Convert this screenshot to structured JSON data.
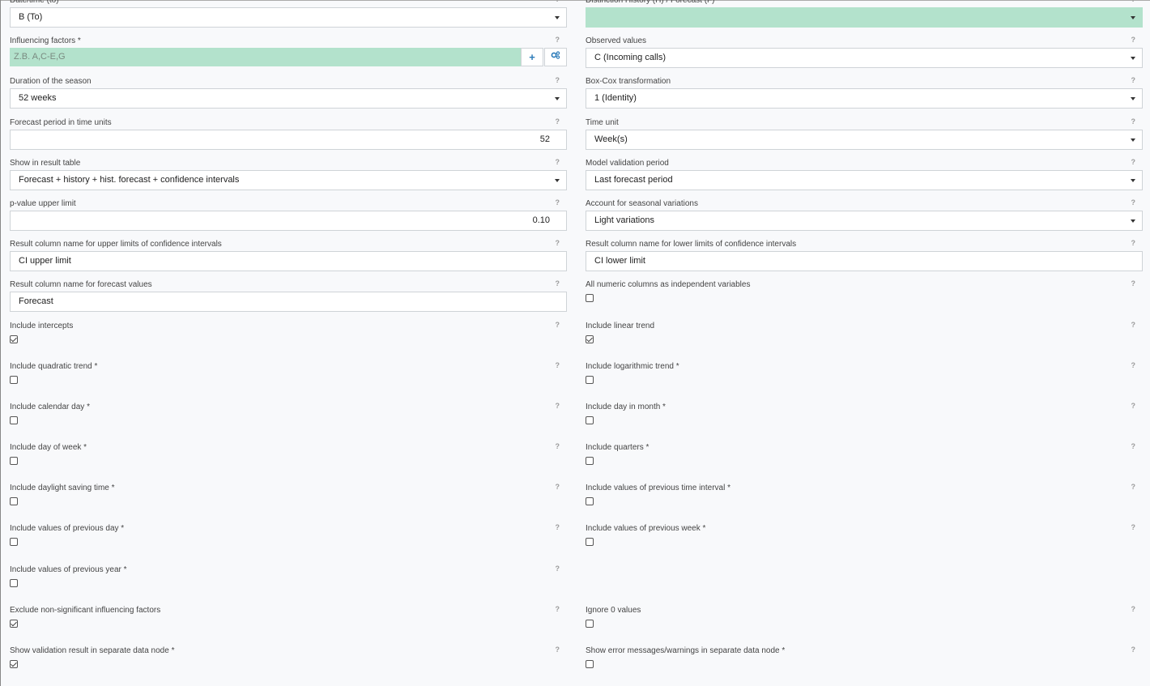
{
  "left": [
    {
      "label": "Date/time (to)",
      "type": "select",
      "value": "B (To)"
    },
    {
      "label": "Influencing factors *",
      "type": "text-buttons",
      "value": "Z.B. A,C-E,G",
      "buttons": [
        "plus-icon",
        "gears-icon"
      ]
    },
    {
      "label": "Duration of the season",
      "type": "select",
      "value": "52 weeks"
    },
    {
      "label": "Forecast period in time units",
      "type": "number",
      "value": "52"
    },
    {
      "label": "Show in result table",
      "type": "select",
      "value": "Forecast + history + hist. forecast + confidence intervals"
    },
    {
      "label": "p-value upper limit",
      "type": "number",
      "value": "0.10"
    },
    {
      "label": "Result column name for upper limits of confidence intervals",
      "type": "text",
      "value": "CI upper limit"
    },
    {
      "label": "Result column name for forecast values",
      "type": "text",
      "value": "Forecast"
    },
    {
      "label": "Include intercepts",
      "type": "checkbox",
      "checked": true
    },
    {
      "label": "Include quadratic trend *",
      "type": "checkbox",
      "checked": false
    },
    {
      "label": "Include calendar day *",
      "type": "checkbox",
      "checked": false
    },
    {
      "label": "Include day of week *",
      "type": "checkbox",
      "checked": false
    },
    {
      "label": "Include daylight saving time *",
      "type": "checkbox",
      "checked": false
    },
    {
      "label": "Include values of previous day *",
      "type": "checkbox",
      "checked": false
    },
    {
      "label": "Include values of previous year *",
      "type": "checkbox",
      "checked": false
    },
    {
      "label": "Exclude non-significant influencing factors",
      "type": "checkbox",
      "checked": true
    },
    {
      "label": "Show validation result in separate data node *",
      "type": "checkbox",
      "checked": true
    }
  ],
  "right": [
    {
      "label": "Distinction History (H) / Forecast (F) *",
      "type": "select-green",
      "value": ""
    },
    {
      "label": "Observed values",
      "type": "select",
      "value": "C (Incoming calls)"
    },
    {
      "label": "Box-Cox transformation",
      "type": "select",
      "value": "1 (Identity)"
    },
    {
      "label": "Time unit",
      "type": "select",
      "value": "Week(s)"
    },
    {
      "label": "Model validation period",
      "type": "select",
      "value": "Last forecast period"
    },
    {
      "label": "Account for seasonal variations",
      "type": "select",
      "value": "Light variations"
    },
    {
      "label": "Result column name for lower limits of confidence intervals",
      "type": "text",
      "value": "CI lower limit"
    },
    {
      "label": "All numeric columns as independent variables",
      "type": "checkbox",
      "checked": false
    },
    {
      "label": "Include linear trend",
      "type": "checkbox",
      "checked": true
    },
    {
      "label": "Include logarithmic trend *",
      "type": "checkbox",
      "checked": false
    },
    {
      "label": "Include day in month *",
      "type": "checkbox",
      "checked": false
    },
    {
      "label": "Include quarters *",
      "type": "checkbox",
      "checked": false
    },
    {
      "label": "Include values of previous time interval *",
      "type": "checkbox",
      "checked": false
    },
    {
      "label": "Include values of previous week *",
      "type": "checkbox",
      "checked": false
    },
    {
      "label": "",
      "type": "empty"
    },
    {
      "label": "Ignore 0 values",
      "type": "checkbox",
      "checked": false
    },
    {
      "label": "Show error messages/warnings in separate data node *",
      "type": "checkbox",
      "checked": false
    }
  ],
  "help_glyph": "?",
  "colors": {
    "accent_green": "#b3e2cc",
    "button_blue": "#2b7bb9"
  }
}
